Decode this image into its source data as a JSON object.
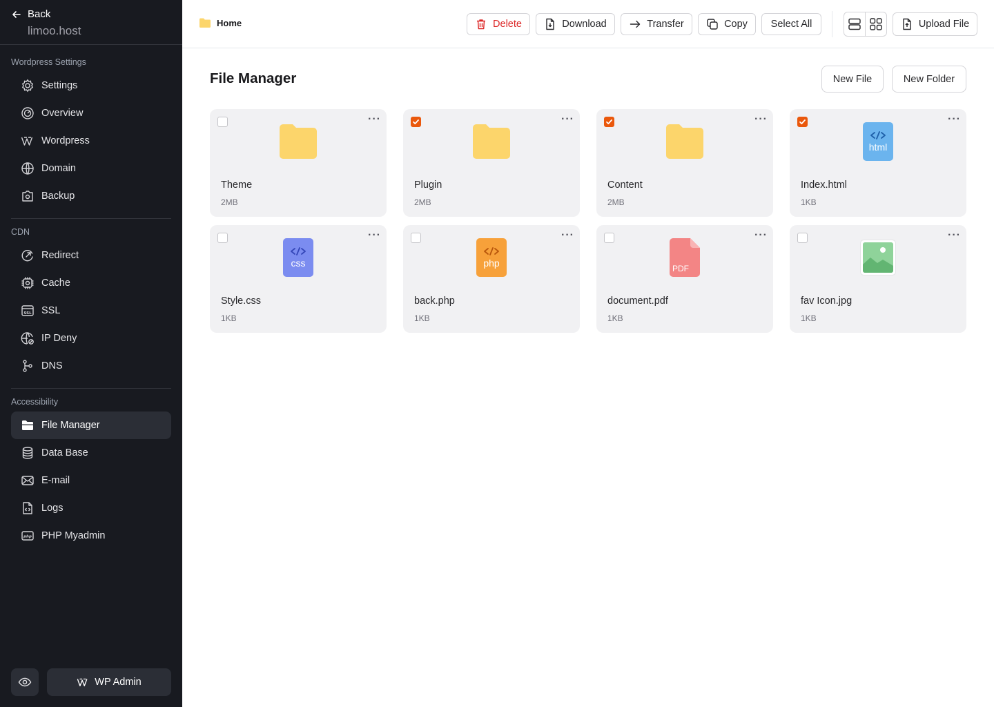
{
  "sidebar": {
    "back_label": "Back",
    "site_name": "limoo.host",
    "sections": {
      "wordpress": "Wordpress Settings",
      "cdn": "CDN",
      "accessibility": "Accessibility"
    },
    "items": {
      "settings": "Settings",
      "overview": "Overview",
      "wordpress": "Wordpress",
      "domain": "Domain",
      "backup": "Backup",
      "redirect": "Redirect",
      "cache": "Cache",
      "ssl": "SSL",
      "ip_deny": "IP Deny",
      "dns": "DNS",
      "file_manager": "File Manager",
      "data_base": "Data Base",
      "email": "E-mail",
      "logs": "Logs",
      "php_myadmin": "PHP Myadmin"
    },
    "active_item": "File Manager",
    "wp_admin_label": "WP Admin"
  },
  "toolbar": {
    "breadcrumb": "Home",
    "delete_label": "Delete",
    "download_label": "Download",
    "transfer_label": "Transfer",
    "copy_label": "Copy",
    "select_all_label": "Select All",
    "upload_label": "Upload File"
  },
  "main": {
    "title": "File Manager",
    "new_file_label": "New File",
    "new_folder_label": "New Folder",
    "files": [
      {
        "name": "Theme",
        "size": "2MB",
        "type": "folder",
        "checked": false
      },
      {
        "name": "Plugin",
        "size": "2MB",
        "type": "folder",
        "checked": true
      },
      {
        "name": "Content",
        "size": "2MB",
        "type": "folder",
        "checked": true
      },
      {
        "name": "Index.html",
        "size": "1KB",
        "type": "html",
        "tag": "html",
        "checked": true
      },
      {
        "name": "Style.css",
        "size": "1KB",
        "type": "css",
        "tag": "css",
        "checked": false
      },
      {
        "name": "back.php",
        "size": "1KB",
        "type": "php",
        "tag": "php",
        "checked": false
      },
      {
        "name": "document.pdf",
        "size": "1KB",
        "type": "pdf",
        "tag": "PDF",
        "checked": false
      },
      {
        "name": "fav Icon.jpg",
        "size": "1KB",
        "type": "image",
        "checked": false
      }
    ]
  },
  "colors": {
    "sidebar_bg": "#181a20",
    "accent_checkbox": "#ea580c",
    "danger": "#dc2626",
    "folder": "#fcd56b",
    "html_tile": "#6bb4ee",
    "css_tile": "#7b8cf0",
    "php_tile": "#f7a13a",
    "pdf_tile": "#f38585",
    "image_tile": "#8fd39a"
  }
}
